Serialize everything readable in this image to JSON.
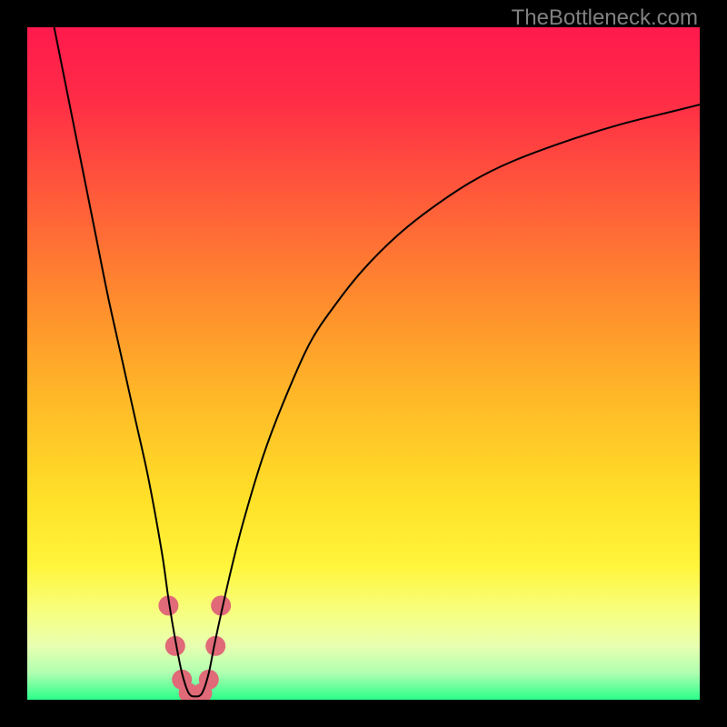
{
  "watermark": "TheBottleneck.com",
  "chart_data": {
    "type": "line",
    "title": "",
    "xlabel": "",
    "ylabel": "",
    "xlim": [
      0,
      100
    ],
    "ylim": [
      0,
      100
    ],
    "grid": false,
    "legend": false,
    "background_gradient": {
      "stops": [
        {
          "offset": 0.0,
          "color": "#ff1a4d"
        },
        {
          "offset": 0.1,
          "color": "#ff2a47"
        },
        {
          "offset": 0.25,
          "color": "#ff5a3a"
        },
        {
          "offset": 0.4,
          "color": "#ff8a2e"
        },
        {
          "offset": 0.55,
          "color": "#ffb828"
        },
        {
          "offset": 0.7,
          "color": "#ffe028"
        },
        {
          "offset": 0.8,
          "color": "#fff53a"
        },
        {
          "offset": 0.87,
          "color": "#f7ff80"
        },
        {
          "offset": 0.92,
          "color": "#e8ffb0"
        },
        {
          "offset": 0.96,
          "color": "#b0ffb0"
        },
        {
          "offset": 1.0,
          "color": "#2aff8a"
        }
      ]
    },
    "series": [
      {
        "name": "bottleneck-curve",
        "color": "#000000",
        "stroke_width": 2,
        "x": [
          4,
          6,
          8,
          10,
          12,
          14,
          16,
          18,
          20,
          21,
          22,
          23,
          24,
          25,
          26,
          27,
          28,
          30,
          32,
          35,
          38,
          42,
          46,
          50,
          55,
          60,
          66,
          72,
          80,
          88,
          96,
          100
        ],
        "values": [
          100,
          90,
          80,
          70,
          60,
          51,
          42,
          33,
          22,
          15,
          9,
          4,
          1,
          0.5,
          1,
          4,
          9,
          18,
          26,
          36,
          44,
          53,
          59,
          64,
          69,
          73,
          77,
          80,
          83,
          85.5,
          87.5,
          88.5
        ]
      }
    ],
    "markers": {
      "name": "bottom-cluster",
      "color": "#e06a78",
      "radius": 11,
      "points": [
        {
          "x": 21.0,
          "y": 14
        },
        {
          "x": 22.0,
          "y": 8
        },
        {
          "x": 23.0,
          "y": 3
        },
        {
          "x": 24.0,
          "y": 1
        },
        {
          "x": 25.0,
          "y": 0.5
        },
        {
          "x": 26.0,
          "y": 1
        },
        {
          "x": 27.0,
          "y": 3
        },
        {
          "x": 28.0,
          "y": 8
        },
        {
          "x": 28.8,
          "y": 14
        }
      ]
    }
  }
}
